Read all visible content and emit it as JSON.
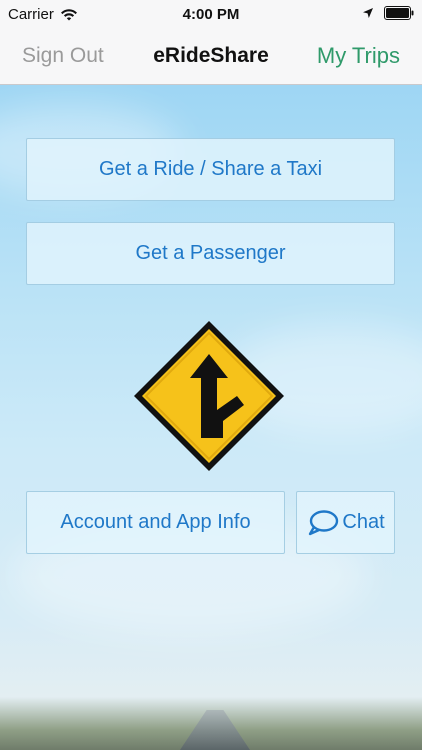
{
  "status_bar": {
    "carrier": "Carrier",
    "time": "4:00 PM"
  },
  "nav": {
    "left_label": "Sign Out",
    "title": "eRideShare",
    "right_label": "My Trips"
  },
  "buttons": {
    "get_ride": "Get a Ride / Share a Taxi",
    "get_passenger": "Get a Passenger",
    "account_info": "Account and App Info",
    "chat": "Chat"
  },
  "icons": {
    "wifi": "wifi-icon",
    "location": "location-arrow-icon",
    "battery": "battery-icon",
    "merge_sign": "merge-road-sign-icon",
    "chat": "chat-bubble-icon"
  },
  "colors": {
    "link_blue": "#1f78c8",
    "trips_green": "#2f9a6a",
    "sign_yellow": "#f6c21a"
  }
}
